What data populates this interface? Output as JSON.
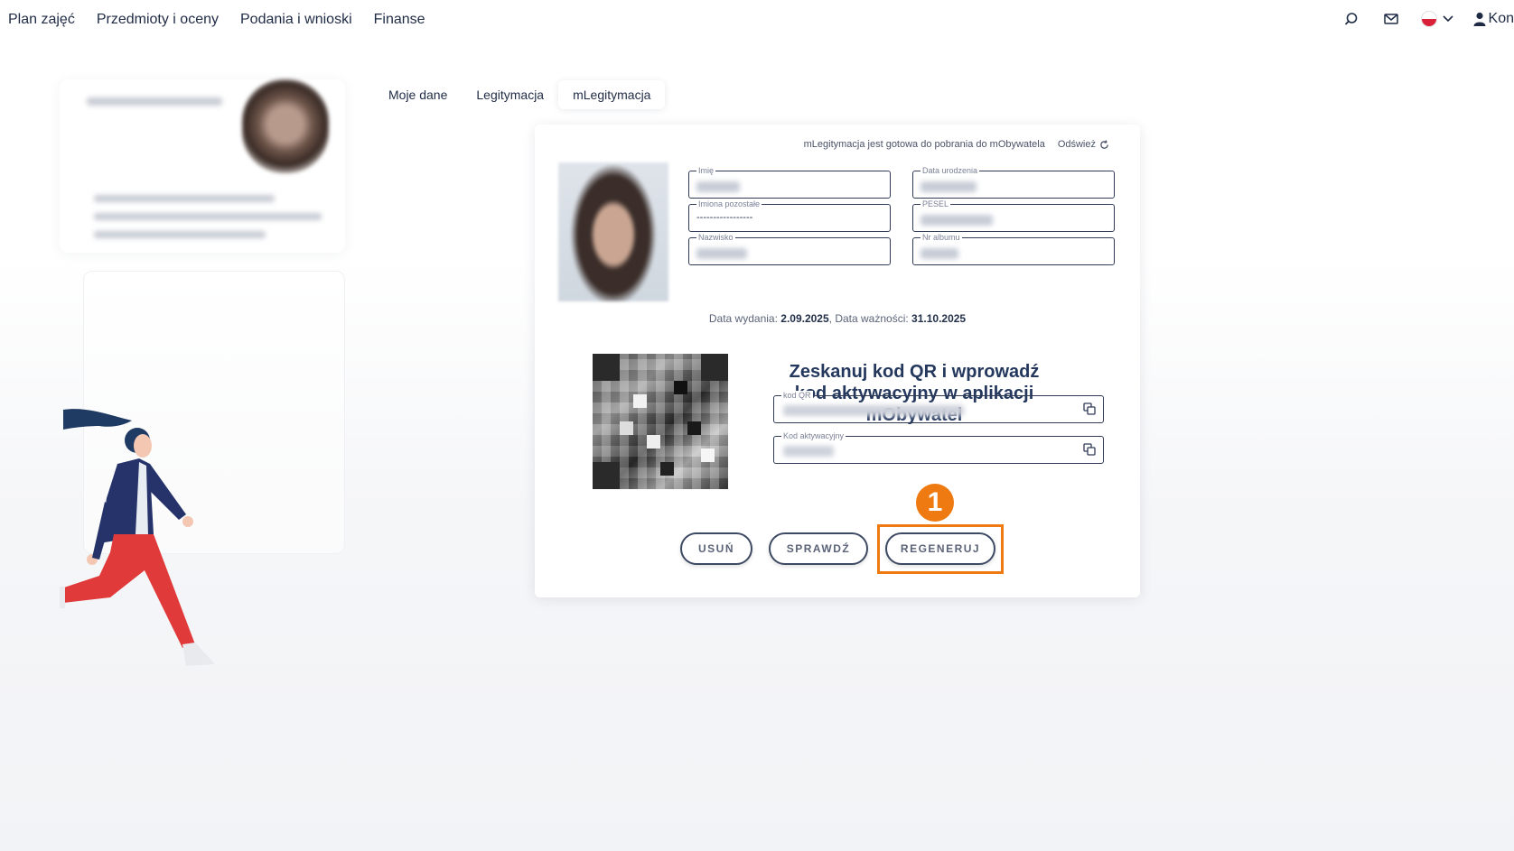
{
  "nav": {
    "items": [
      "Plan zajęć",
      "Przedmioty i oceny",
      "Podania i wnioski",
      "Finanse"
    ],
    "account_label": "Kon"
  },
  "tabs": [
    {
      "label": "Moje dane",
      "active": false
    },
    {
      "label": "Legitymacja",
      "active": false
    },
    {
      "label": "mLegitymacja",
      "active": true
    }
  ],
  "card": {
    "status_text": "mLegitymacja jest gotowa do pobrania do mObywatela",
    "refresh_label": "Odśwież",
    "fields": {
      "imie": {
        "label": "Imię"
      },
      "imiona": {
        "label": "Imiona pozostałe",
        "value": "-----------------"
      },
      "nazwisko": {
        "label": "Nazwisko"
      },
      "data_urodzenia": {
        "label": "Data urodzenia"
      },
      "pesel": {
        "label": "PESEL"
      },
      "nr_albumu": {
        "label": "Nr albumu"
      }
    },
    "dates": {
      "issue_label": "Data wydania:",
      "issue_value": "2.09.2025",
      "expiry_label": "Data ważności:",
      "expiry_value": "31.10.2025"
    },
    "qr_heading": "Zeskanuj kod QR i wprowadź kod aktywacyjny w aplikacji mObywatel",
    "qr_code_label": "kod QR",
    "activation_code_label": "Kod aktywacyjny",
    "buttons": {
      "delete": "USUŃ",
      "check": "SPRAWDŹ",
      "regenerate": "REGENERUJ"
    }
  },
  "annotation": {
    "step_number": "1",
    "color": "#f07a12"
  },
  "colors": {
    "accent": "#f07a12",
    "primary_text": "#1f2b45",
    "heading": "#24385e",
    "flag_red": "#d9213a"
  }
}
